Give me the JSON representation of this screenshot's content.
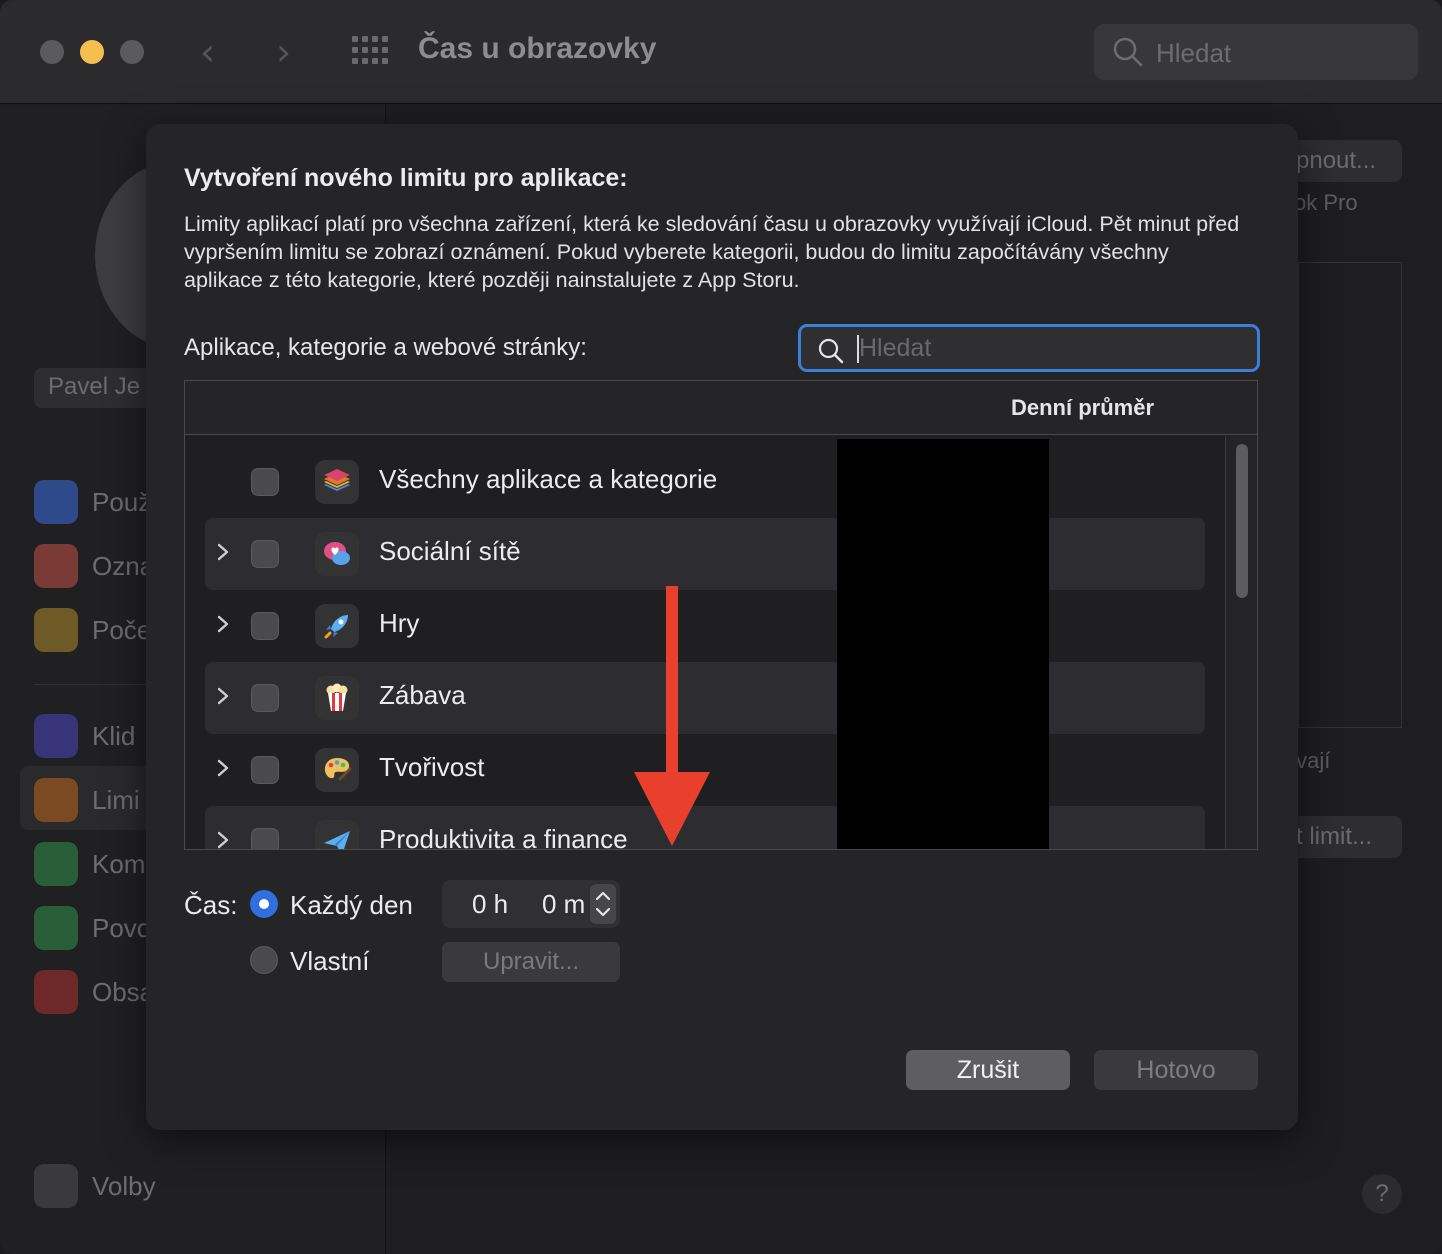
{
  "window": {
    "title": "Čas u obrazovky",
    "search_placeholder": "Hledat"
  },
  "sidebar": {
    "user_name": "Pavel Je",
    "items": [
      {
        "label": "Použ",
        "icon": "bar-chart-icon",
        "color": "#3a67c7"
      },
      {
        "label": "Ozna",
        "icon": "bell-icon",
        "color": "#c7453a"
      },
      {
        "label": "Poče",
        "icon": "phone-pickup-icon",
        "color": "#c79a2a"
      },
      {
        "label": "Klid",
        "icon": "downtime-icon",
        "color": "#5a4fc7"
      },
      {
        "label": "Limi",
        "icon": "hourglass-icon",
        "color": "#d0782a"
      },
      {
        "label": "Kom",
        "icon": "contacts-icon",
        "color": "#3aa85a"
      },
      {
        "label": "Povo",
        "icon": "checkmark-shield-icon",
        "color": "#3aa85a"
      },
      {
        "label": "Obsa",
        "icon": "restriction-icon",
        "color": "#c73a3a"
      }
    ],
    "options_label": "Volby"
  },
  "background": {
    "button_text": "pnout...",
    "device_text": "ok Pro",
    "side_text": "ívají",
    "limit_button_text": "t limit..."
  },
  "sheet": {
    "title": "Vytvoření nového limitu pro aplikace:",
    "description": "Limity aplikací platí pro všechna zařízení, která ke sledování času u obrazovky využívají iCloud. Pět minut před vypršením limitu se zobrazí oznámení. Pokud vyberete kategorii, budou do limitu započítávány všechny aplikace z této kategorie, které později nainstalujete z App Storu.",
    "list_label": "Aplikace, kategorie a webové stránky:",
    "search_placeholder": "Hledat",
    "column_header": "Denní průměr",
    "rows": [
      {
        "label": "Všechny aplikace a kategorie",
        "icon": "stacked-layers-icon",
        "expandable": false,
        "checked": false
      },
      {
        "label": "Sociální sítě",
        "icon": "chat-heart-icon",
        "expandable": true,
        "checked": false
      },
      {
        "label": "Hry",
        "icon": "rocket-icon",
        "expandable": true,
        "checked": false
      },
      {
        "label": "Zábava",
        "icon": "popcorn-icon",
        "expandable": true,
        "checked": false
      },
      {
        "label": "Tvořivost",
        "icon": "palette-icon",
        "expandable": true,
        "checked": false
      },
      {
        "label": "Produktivita a finance",
        "icon": "paper-plane-icon",
        "expandable": true,
        "checked": false
      }
    ],
    "time_label": "Čas:",
    "every_day_label": "Každý den",
    "custom_label": "Vlastní",
    "hours_value": "0 h",
    "minutes_value": "0 m",
    "edit_button": "Upravit...",
    "cancel_button": "Zrušit",
    "done_button": "Hotovo"
  },
  "colors": {
    "accent": "#3b7fd9",
    "arrow": "#e8402c"
  }
}
